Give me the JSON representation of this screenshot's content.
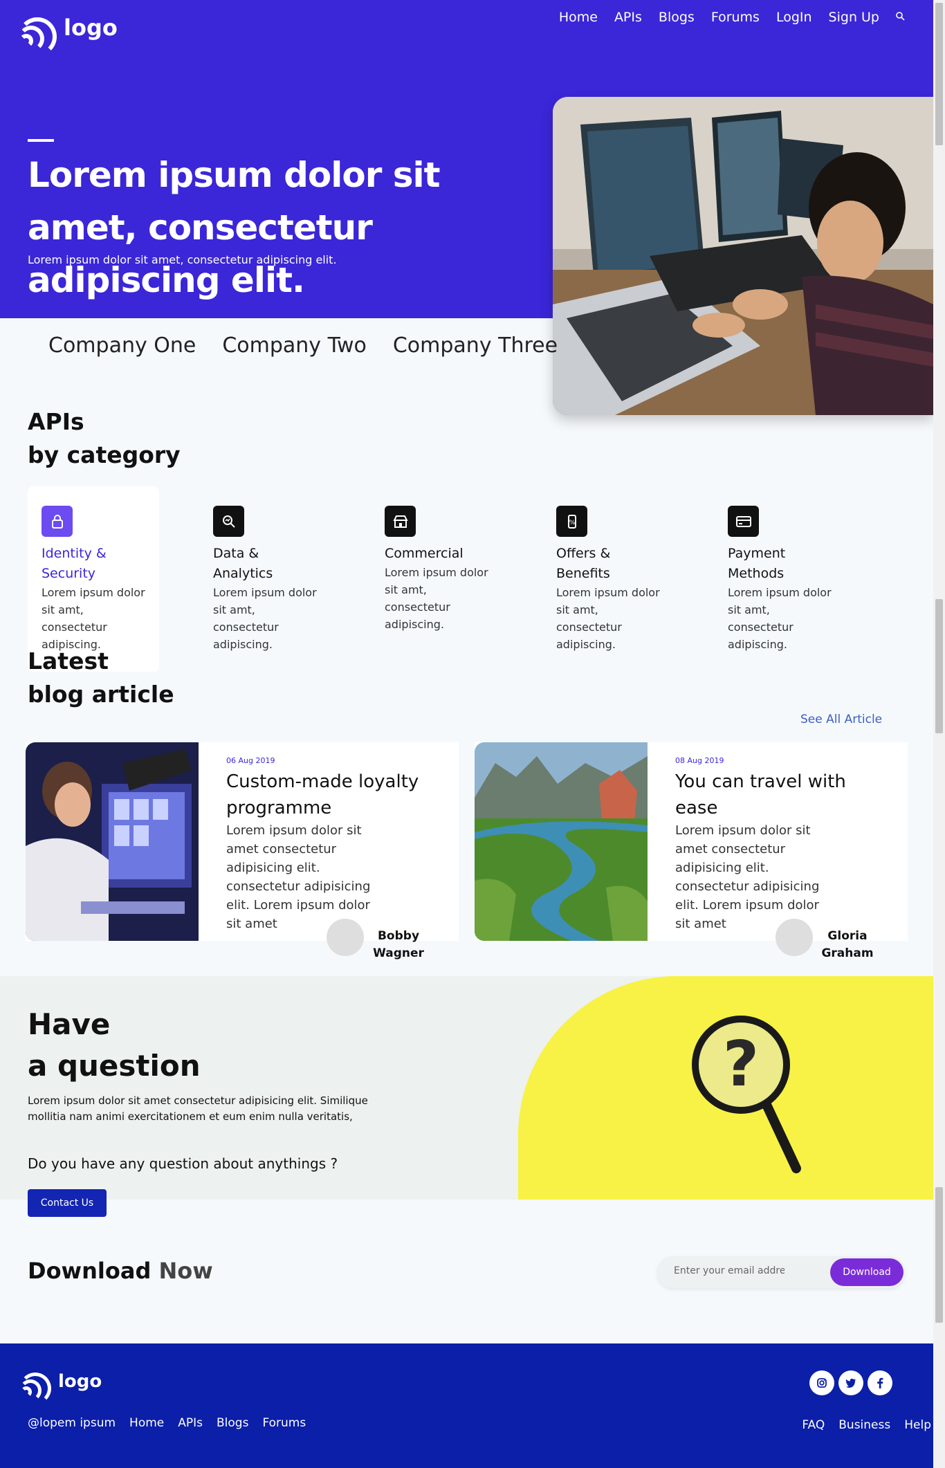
{
  "header": {
    "logo_text": "logo",
    "nav": [
      "Home",
      "APIs",
      "Blogs",
      "Forums",
      "LogIn",
      "Sign Up"
    ]
  },
  "hero": {
    "title": "Lorem ipsum dolor sit amet, consectetur adipiscing elit.",
    "subtitle": "Lorem ipsum dolor sit amet, consectetur adipiscing elit."
  },
  "companies": [
    "Company One",
    "Company Two",
    "Company Three"
  ],
  "apis": {
    "title_1": "APIs",
    "title_2": "by category",
    "categories": [
      {
        "title": "Identity & Security",
        "desc": "Lorem ipsum dolor sit amt, consectetur adipiscing.",
        "icon": "lock-icon"
      },
      {
        "title": "Data & Analytics",
        "desc": "Lorem ipsum dolor sit amt, consectetur adipiscing.",
        "icon": "analytics-icon"
      },
      {
        "title": "Commercial",
        "desc": "Lorem ipsum dolor sit amt, consectetur adipiscing.",
        "icon": "store-icon"
      },
      {
        "title": "Offers & Benefits",
        "desc": "Lorem ipsum dolor sit amt, consectetur adipiscing.",
        "icon": "offer-icon"
      },
      {
        "title": "Payment Methods",
        "desc": "Lorem ipsum dolor sit amt, consectetur adipiscing.",
        "icon": "card-icon"
      }
    ]
  },
  "blog": {
    "title_1": "Latest",
    "title_2": "blog article",
    "see_all": "See All Article",
    "posts": [
      {
        "date": "06 Aug 2019",
        "title": "Custom-made loyalty programme",
        "text": "Lorem ipsum dolor sit amet consectetur adipisicing elit. consectetur adipisicing elit. Lorem ipsum dolor sit amet",
        "author": "Bobby Wagner"
      },
      {
        "date": "08 Aug 2019",
        "title": "You can travel with ease",
        "text": "Lorem ipsum dolor sit amet consectetur adipisicing elit. consectetur adipisicing elit. Lorem ipsum dolor sit amet",
        "author": "Gloria Graham"
      }
    ]
  },
  "question": {
    "title_1": "Have",
    "title_2": "a question",
    "text": "Lorem ipsum dolor sit amet consectetur adipisicing elit. Similique mollitia nam animi exercitationem et eum enim nulla veritatis,",
    "ask": "Do you have any question about anythings ?",
    "button": "Contact Us"
  },
  "download": {
    "title_a": "Download",
    "title_b": "Now",
    "placeholder": "Enter your email address",
    "button": "Download"
  },
  "footer": {
    "logo_text": "logo",
    "nav": [
      "@lopem ipsum",
      "Home",
      "APIs",
      "Blogs",
      "Forums"
    ],
    "right": [
      "FAQ",
      "Business",
      "Help"
    ],
    "social": [
      "instagram-icon",
      "twitter-icon",
      "facebook-icon"
    ]
  },
  "colors": {
    "primary": "#3b26d8",
    "footer": "#0b1fa8",
    "accent": "#7b2cd9",
    "highlight": "#f7f245"
  }
}
